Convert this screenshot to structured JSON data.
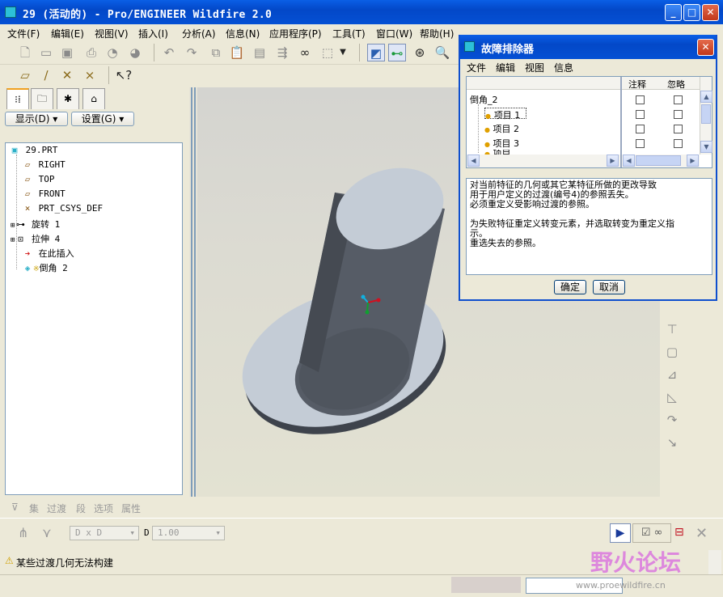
{
  "window": {
    "title": "29 (活动的) - Pro/ENGINEER Wildfire 2.0"
  },
  "menubar": [
    "文件(F)",
    "编辑(E)",
    "视图(V)",
    "插入(I)",
    "分析(A)",
    "信息(N)",
    "应用程序(P)",
    "工具(T)",
    "窗口(W)",
    "帮助(H)"
  ],
  "left_panel": {
    "display_button": "显示(D)",
    "settings_button": "设置(G)",
    "tree": [
      {
        "label": "29.PRT",
        "icon": "part-icon"
      },
      {
        "label": "RIGHT",
        "icon": "datum-plane-icon"
      },
      {
        "label": "TOP",
        "icon": "datum-plane-icon"
      },
      {
        "label": "FRONT",
        "icon": "datum-plane-icon"
      },
      {
        "label": "PRT_CSYS_DEF",
        "icon": "csys-icon"
      },
      {
        "label": "旋转 1",
        "icon": "revolve-icon"
      },
      {
        "label": "拉伸 4",
        "icon": "extrude-icon"
      },
      {
        "label": "在此插入",
        "icon": "insert-arrow-icon"
      },
      {
        "label": "倒角 2",
        "icon": "chamfer-icon"
      }
    ]
  },
  "dashboard": {
    "tabs": [
      "集",
      "过渡",
      "段",
      "选项",
      "属性"
    ],
    "dim_scheme": "D x D",
    "d_label": "D",
    "d_value": "1.00"
  },
  "status": {
    "message": "某些过渡几何无法构建"
  },
  "watermark": {
    "text": "野火论坛",
    "url": "www.proewildfire.cn"
  },
  "dialog": {
    "title": "故障排除器",
    "menu": [
      "文件",
      "编辑",
      "视图",
      "信息"
    ],
    "columns": [
      "注释",
      "忽略"
    ],
    "root": "倒角_2",
    "items": [
      "项目 1",
      "项目 2",
      "项目 3",
      "项目"
    ],
    "message_lines": [
      "对当前特征的几何或其它某特征所做的更改导致",
      "用于用户定义的过渡(编号4)的参照丢失。",
      "必须重定义受影响过渡的参照。",
      "",
      "为失败特征重定义转变元素，并选取转变为重定义指",
      "示。",
      "重选失去的参照。"
    ],
    "ok_button": "确定",
    "cancel_button": "取消"
  },
  "colors": {
    "title_blue": "#0450d4",
    "part_gray": "#565c66",
    "flange": "#c4ccd6"
  }
}
